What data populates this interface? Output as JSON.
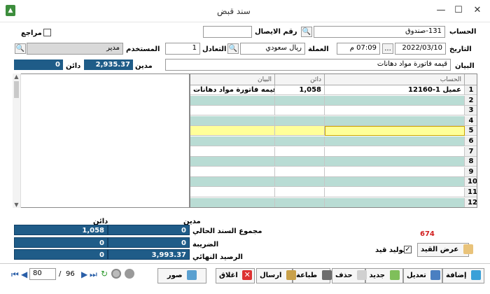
{
  "window": {
    "title": "سند قبض",
    "app_icon": "app-icon"
  },
  "header": {
    "account_label": "الحساب",
    "account_value": "131-صندوق",
    "receipt_no_label": "رقم الايصال",
    "receipt_no_value": "",
    "reviewed_label": "مراجع",
    "date_label": "التاريخ",
    "date_value": "2022/03/10",
    "date_btn": "...",
    "time_value": "07:09 م",
    "currency_label": "العملة",
    "currency_value": "ريال سعودي",
    "rate_label": "التعادل",
    "rate_value": "1",
    "user_label": "المستخدم",
    "user_value": "مدير",
    "statement_label": "البيان",
    "statement_value": "قيمه فاتورة مواد دهانات",
    "debit_label": "مدين",
    "debit_value": "2,935.37",
    "credit_label": "دائن",
    "credit_value": "0"
  },
  "grid": {
    "columns": [
      "الحساب",
      "دائن",
      "البيان"
    ],
    "rows": [
      {
        "num": "1",
        "account": "12160-عميل 1",
        "credit": "1,058",
        "statement": "قيمه فاتورة مواد دهانات"
      },
      {
        "num": "2",
        "account": "",
        "credit": "",
        "statement": ""
      },
      {
        "num": "3",
        "account": "",
        "credit": "",
        "statement": ""
      },
      {
        "num": "4",
        "account": "",
        "credit": "",
        "statement": ""
      },
      {
        "num": "5",
        "account": "",
        "credit": "",
        "statement": ""
      },
      {
        "num": "6",
        "account": "",
        "credit": "",
        "statement": ""
      },
      {
        "num": "7",
        "account": "",
        "credit": "",
        "statement": ""
      },
      {
        "num": "8",
        "account": "",
        "credit": "",
        "statement": ""
      },
      {
        "num": "9",
        "account": "",
        "credit": "",
        "statement": ""
      },
      {
        "num": "10",
        "account": "",
        "credit": "",
        "statement": ""
      },
      {
        "num": "11",
        "account": "",
        "credit": "",
        "statement": ""
      },
      {
        "num": "12",
        "account": "",
        "credit": "",
        "statement": ""
      }
    ],
    "colors": {
      "alt_row": "#b9dcd4",
      "selected_row": "#ffff99"
    }
  },
  "totals": {
    "debit_header": "مدين",
    "credit_header": "دائن",
    "current_total_label": "مجموع السند الحالي",
    "current_debit": "0",
    "current_credit": "1,058",
    "tax_label": "الضريبة",
    "tax_debit": "0",
    "tax_credit": "0",
    "final_balance_label": "الرصيد النهائي",
    "final_debit": "3,993.37",
    "final_credit": "0"
  },
  "side": {
    "id_value": "674",
    "generate_entry_label": "توليد قيد",
    "show_entry_label": "عرض القيد"
  },
  "toolbar": {
    "add": "إضافة",
    "edit": "تعديل",
    "new": "جديد",
    "delete": "حذف",
    "print": "طباعة",
    "send": "ارسال",
    "close": "اغلاق",
    "images": "صور"
  },
  "nav": {
    "total": "96",
    "current": "80",
    "separator": "/"
  }
}
